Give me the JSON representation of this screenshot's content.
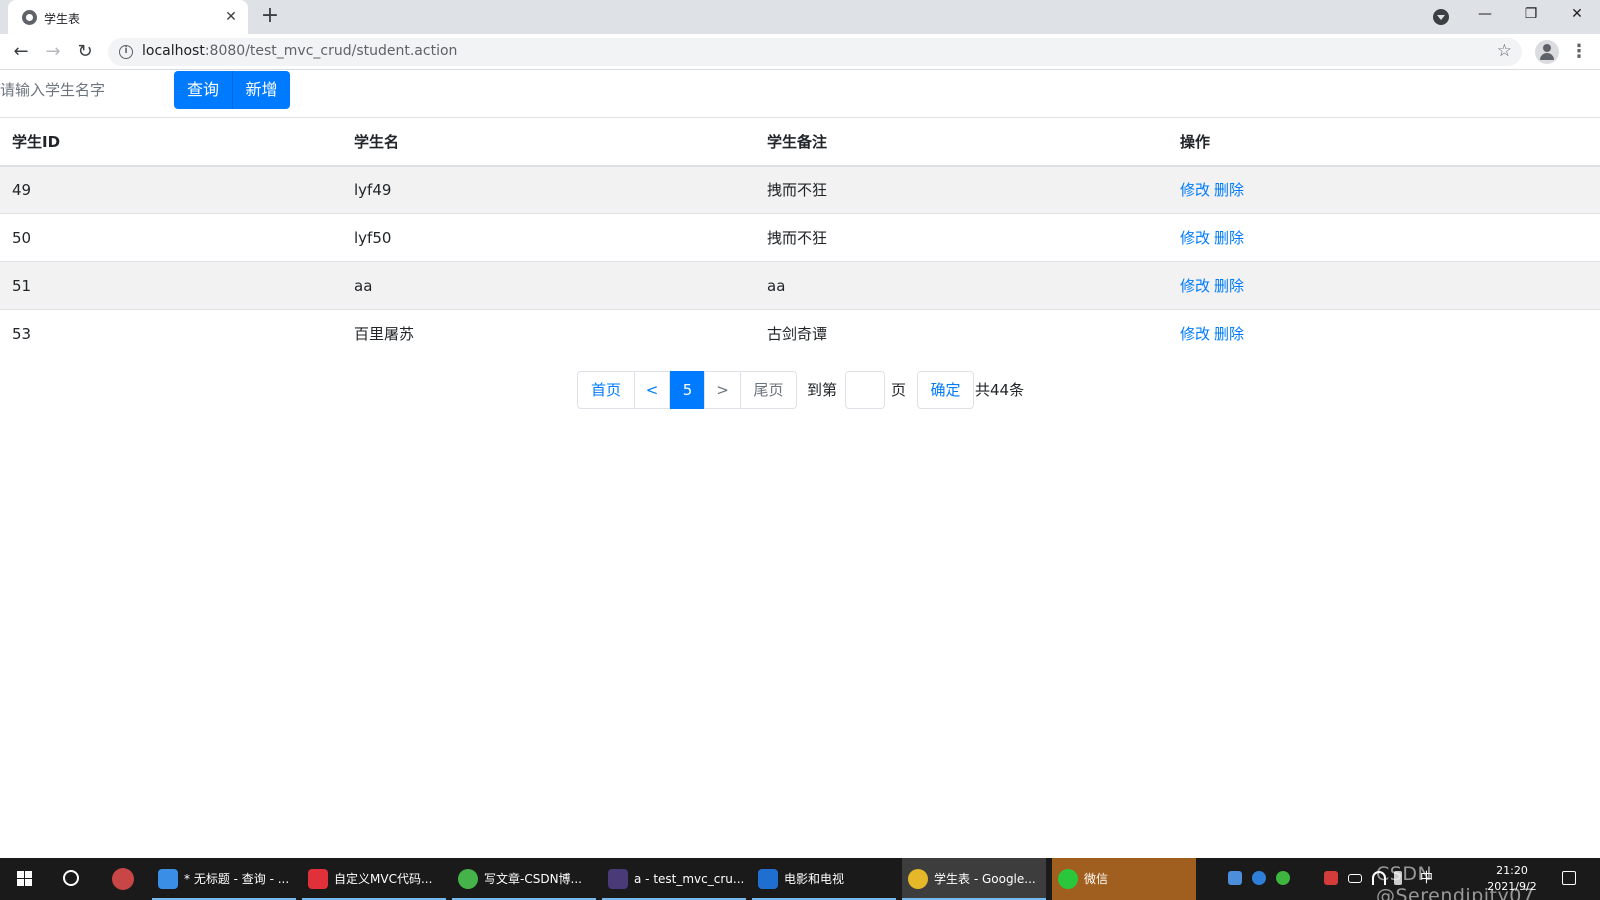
{
  "browser": {
    "tab_title": "学生表",
    "tab_close": "✕",
    "new_tab": "+",
    "url_host": "localhost",
    "url_rest": ":8080/test_mvc_crud/student.action",
    "window_min": "—",
    "window_max": "❐",
    "window_close": "✕",
    "back": "←",
    "forward": "→",
    "reload": "↻",
    "info": "i",
    "star": "☆",
    "menu": "⋮"
  },
  "search": {
    "placeholder": "请输入学生名字",
    "query_label": "查询",
    "add_label": "新增"
  },
  "table": {
    "headers": [
      "学生ID",
      "学生名",
      "学生备注",
      "操作"
    ],
    "rows": [
      {
        "id": "49",
        "name": "lyf49",
        "note": "拽而不狂",
        "edit": "修改",
        "delete": "删除"
      },
      {
        "id": "50",
        "name": "lyf50",
        "note": "拽而不狂",
        "edit": "修改",
        "delete": "删除"
      },
      {
        "id": "51",
        "name": "aa",
        "note": "aa",
        "edit": "修改",
        "delete": "删除"
      },
      {
        "id": "53",
        "name": "百里屠苏",
        "note": "古剑奇谭",
        "edit": "修改",
        "delete": "删除"
      }
    ]
  },
  "pagination": {
    "first": "首页",
    "prev": "<",
    "current": "5",
    "next": ">",
    "last": "尾页",
    "goto_label": "到第",
    "page_label": "页",
    "confirm": "确定",
    "total": "共44条",
    "goto_value": ""
  },
  "taskbar": {
    "apps": [
      {
        "label": "* 无标题 - 查询 - ...",
        "icon": "navicat-icon",
        "color": "#3a8ee6"
      },
      {
        "label": "自定义MVC代码...",
        "icon": "xmind-icon",
        "color": "#e0303a"
      },
      {
        "label": "写文章-CSDN博...",
        "icon": "browser-360-icon",
        "color": "#46b34a"
      },
      {
        "label": "a - test_mvc_cru...",
        "icon": "eclipse-icon",
        "color": "#4b3a78"
      },
      {
        "label": "电影和电视",
        "icon": "movies-tv-icon",
        "color": "#1f6fd0"
      },
      {
        "label": "学生表 - Google...",
        "icon": "chrome-icon",
        "color": "#e5b82a"
      },
      {
        "label": "微信",
        "icon": "wechat-icon",
        "color": "#2ac73a"
      }
    ],
    "ime": "中",
    "time": "21:20",
    "date": "2021/9/2",
    "watermark": "CSDN @Serendipity07_"
  }
}
